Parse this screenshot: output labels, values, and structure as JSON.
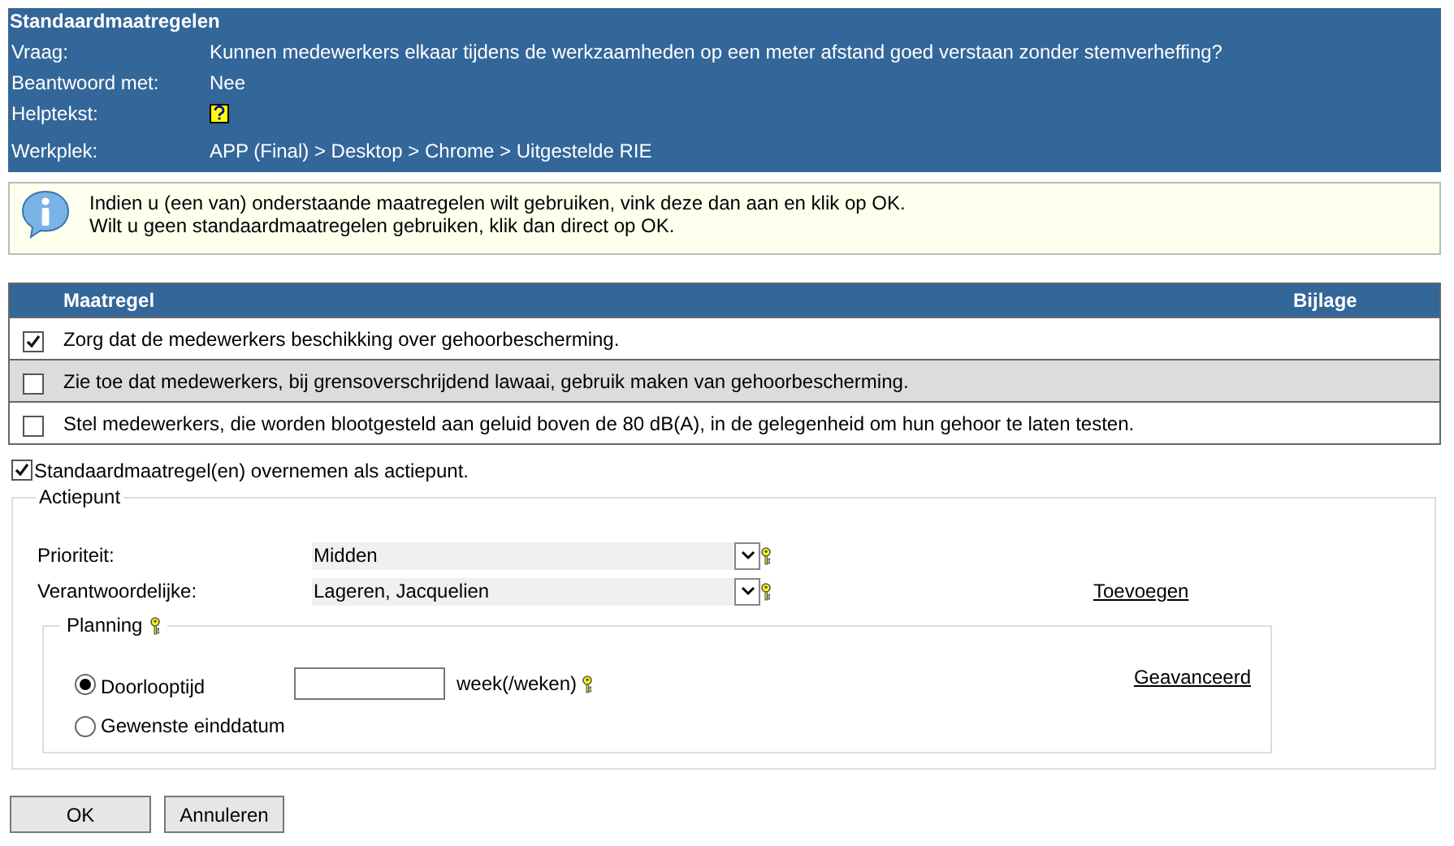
{
  "header": {
    "title": "Standaardmaatregelen",
    "fields": [
      {
        "kind": "text",
        "label": "Vraag:",
        "value": "Kunnen medewerkers elkaar tijdens de werkzaamheden op een meter afstand goed verstaan zonder stemverheffing?"
      },
      {
        "kind": "text",
        "label": "Beantwoord met:",
        "value": "Nee"
      },
      {
        "kind": "help",
        "label": "Helptekst:"
      },
      {
        "kind": "text",
        "label": "Werkplek:",
        "value": "APP (Final) > Desktop > Chrome > Uitgestelde RIE"
      }
    ]
  },
  "info": {
    "lines": [
      "Indien u (een van) onderstaande maatregelen wilt gebruiken, vink deze dan aan en klik op OK.",
      "Wilt u geen standaardmaatregelen gebruiken, klik dan direct op OK."
    ]
  },
  "table": {
    "columns": [
      "Maatregel",
      "Bijlage"
    ],
    "rows": [
      {
        "text": "Zorg dat de medewerkers beschikking over gehoorbescherming.",
        "checked": true,
        "highlighted": false
      },
      {
        "text": "Zie toe dat medewerkers, bij grensoverschrijdend lawaai, gebruik maken van gehoorbescherming.",
        "checked": false,
        "highlighted": true
      },
      {
        "text": "Stel medewerkers, die worden blootgesteld aan geluid boven de 80 dB(A), in de gelegenheid om hun gehoor te laten testen.",
        "checked": false,
        "highlighted": false
      }
    ]
  },
  "adopt": {
    "label": "Standaardmaatregel(en) overnemen als actiepunt.",
    "checked": true
  },
  "actiepunt": {
    "legend": "Actiepunt",
    "fields": [
      {
        "label": "Prioriteit:",
        "value": "Midden"
      },
      {
        "label": "Verantwoordelijke:",
        "value": "Lageren, Jacquelien",
        "link": "Toevoegen"
      }
    ],
    "planning": {
      "legend": "Planning",
      "link": "Geavanceerd",
      "options": [
        {
          "label": "Doorlooptijd",
          "selected": true,
          "unit": "week(/weken)"
        },
        {
          "label": "Gewenste einddatum",
          "selected": false
        }
      ]
    }
  },
  "buttons": [
    "OK",
    "Annuleren"
  ]
}
